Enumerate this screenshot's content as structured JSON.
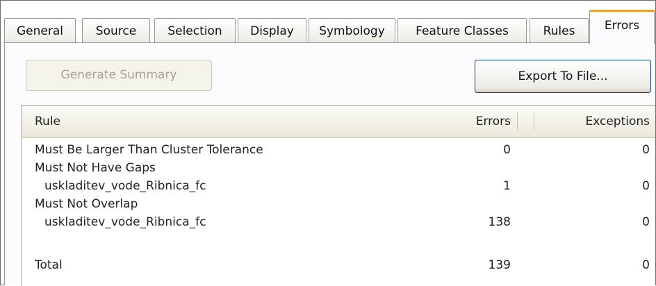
{
  "tabs": [
    {
      "label": "General",
      "active": false
    },
    {
      "label": "Source",
      "active": false
    },
    {
      "label": "Selection",
      "active": false
    },
    {
      "label": "Display",
      "active": false
    },
    {
      "label": "Symbology",
      "active": false
    },
    {
      "label": "Feature Classes",
      "active": false
    },
    {
      "label": "Rules",
      "active": false
    },
    {
      "label": "Errors",
      "active": true
    }
  ],
  "buttons": {
    "generate_summary": "Generate Summary",
    "export_to_file": "Export To File..."
  },
  "table": {
    "columns": [
      "Rule",
      "Errors",
      "Exceptions"
    ],
    "rows": [
      {
        "rule": "Must Be Larger Than Cluster Tolerance",
        "errors": "0",
        "exceptions": "0",
        "indent": false
      },
      {
        "rule": "Must Not Have Gaps",
        "errors": "",
        "exceptions": "",
        "indent": false
      },
      {
        "rule": "uskladitev_vode_Ribnica_fc",
        "errors": "1",
        "exceptions": "0",
        "indent": true
      },
      {
        "rule": "Must Not Overlap",
        "errors": "",
        "exceptions": "",
        "indent": false
      },
      {
        "rule": "uskladitev_vode_Ribnica_fc",
        "errors": "138",
        "exceptions": "0",
        "indent": true
      },
      {
        "rule": "",
        "errors": "",
        "exceptions": "",
        "indent": false
      },
      {
        "rule": "Total",
        "errors": "139",
        "exceptions": "0",
        "indent": false
      }
    ]
  },
  "colors": {
    "active_tab_accent": "#f0a030",
    "button_border": "#003c74"
  }
}
